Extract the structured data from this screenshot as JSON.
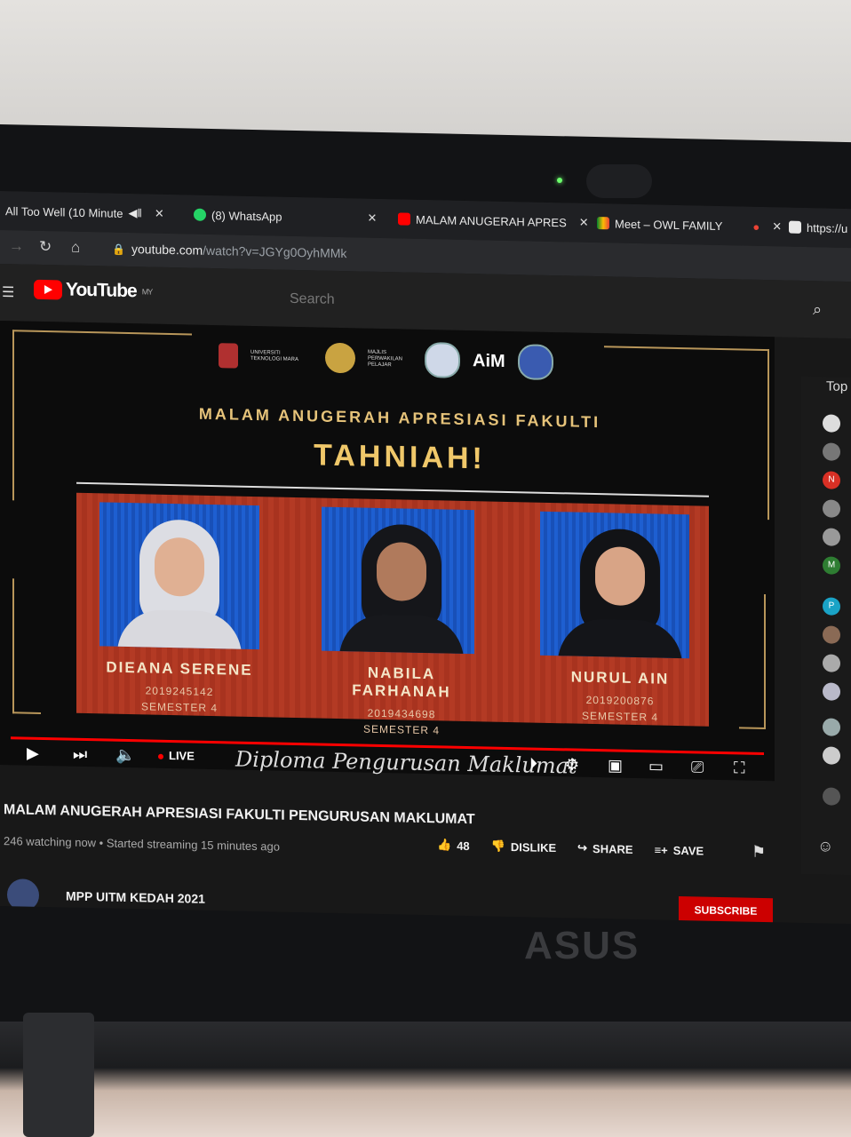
{
  "browser": {
    "tabs": [
      {
        "label": "All Too Well (10 Minute",
        "icon": "speaker-icon"
      },
      {
        "label": "(8) WhatsApp",
        "icon": "whatsapp-icon"
      },
      {
        "label": "MALAM ANUGERAH APRES",
        "icon": "youtube-icon"
      },
      {
        "label": "Meet – OWL FAMILY",
        "icon": "meet-icon"
      },
      {
        "label": "https://u",
        "icon": "page-icon"
      }
    ],
    "url_domain": "youtube.com",
    "url_path": "/watch?v=JGYg0OyhMMk"
  },
  "youtube": {
    "logo": "YouTube",
    "region": "MY",
    "search_placeholder": "Search"
  },
  "video": {
    "event_title": "MALAM ANUGERAH APRESIASI FAKULTI",
    "headline": "TAHNIAH!",
    "logo_aim": "AiM",
    "logo_uitm": "UNIVERSITI TEKNOLOGI MARA",
    "logo_mpp": "MAJLIS PERWAKILAN PELAJAR",
    "winners": [
      {
        "name": "DIEANA SERENE",
        "id": "2019245142",
        "semester": "SEMESTER 4"
      },
      {
        "name": "NABILA FARHANAH",
        "id": "2019434698",
        "semester": "SEMESTER 4"
      },
      {
        "name": "NURUL AIN",
        "id": "2019200876",
        "semester": "SEMESTER 4"
      }
    ],
    "script_text": "Diploma Pengurusan Maklumat",
    "live_label": "LIVE",
    "title": "MALAM ANUGERAH APRESIASI FAKULTI PENGURUSAN MAKLUMAT",
    "views": "246 watching now • Started streaming 15 minutes ago",
    "like_count": "48",
    "dislike_label": "DISLIKE",
    "share_label": "SHARE",
    "save_label": "SAVE"
  },
  "channel": {
    "name": "MPP UITM KEDAH 2021",
    "subscribe_label": "SUBSCRIBE"
  },
  "chat": {
    "header": "Top",
    "avatars": [
      "N",
      "M",
      "P"
    ]
  },
  "device": {
    "brand": "ASUS"
  }
}
